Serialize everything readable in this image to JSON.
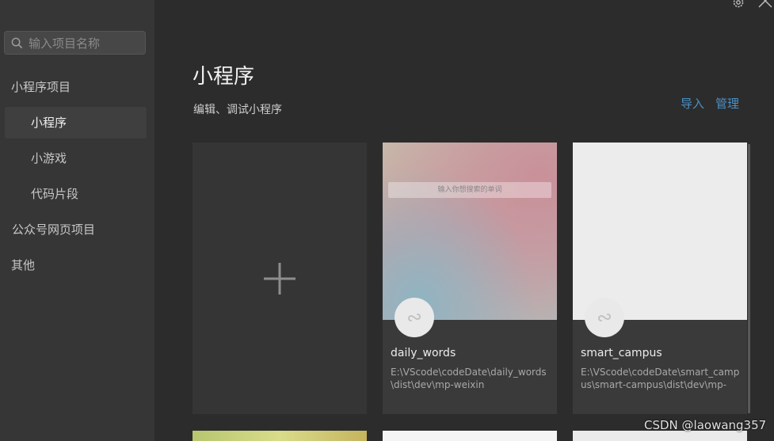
{
  "sidebar": {
    "search": {
      "placeholder": "输入项目名称",
      "icon": "search-icon"
    },
    "items": [
      {
        "label": "小程序项目",
        "active": false
      },
      {
        "label": "小程序",
        "active": true
      },
      {
        "label": "小游戏",
        "active": false
      },
      {
        "label": "代码片段",
        "active": false
      },
      {
        "label": "公众号网页项目",
        "active": false
      },
      {
        "label": "其他",
        "active": false
      }
    ]
  },
  "top_icons": {
    "settings": "gear-icon",
    "close": "close-icon"
  },
  "main": {
    "title": "小程序",
    "subtitle": "编辑、调试小程序",
    "actions": {
      "import": "导入",
      "manage": "管理"
    },
    "projects": [
      {
        "name": "",
        "is_new": true,
        "icon": "plus-icon"
      },
      {
        "name": "daily_words",
        "path": "E:\\VScode\\codeDate\\daily_words\\dist\\dev\\mp-weixin",
        "thumb_search_text": "输入你想搜索的单词",
        "icon": "mini-program-icon"
      },
      {
        "name": "smart_campus",
        "path": "E:\\VScode\\codeDate\\smart_campus\\smart-campus\\dist\\dev\\mp-",
        "icon": "mini-program-icon"
      }
    ]
  },
  "watermark": "CSDN @laowang357",
  "colors": {
    "accent": "#4a90c4",
    "sidebar_bg": "#363636",
    "main_bg": "#2c2c2c"
  }
}
